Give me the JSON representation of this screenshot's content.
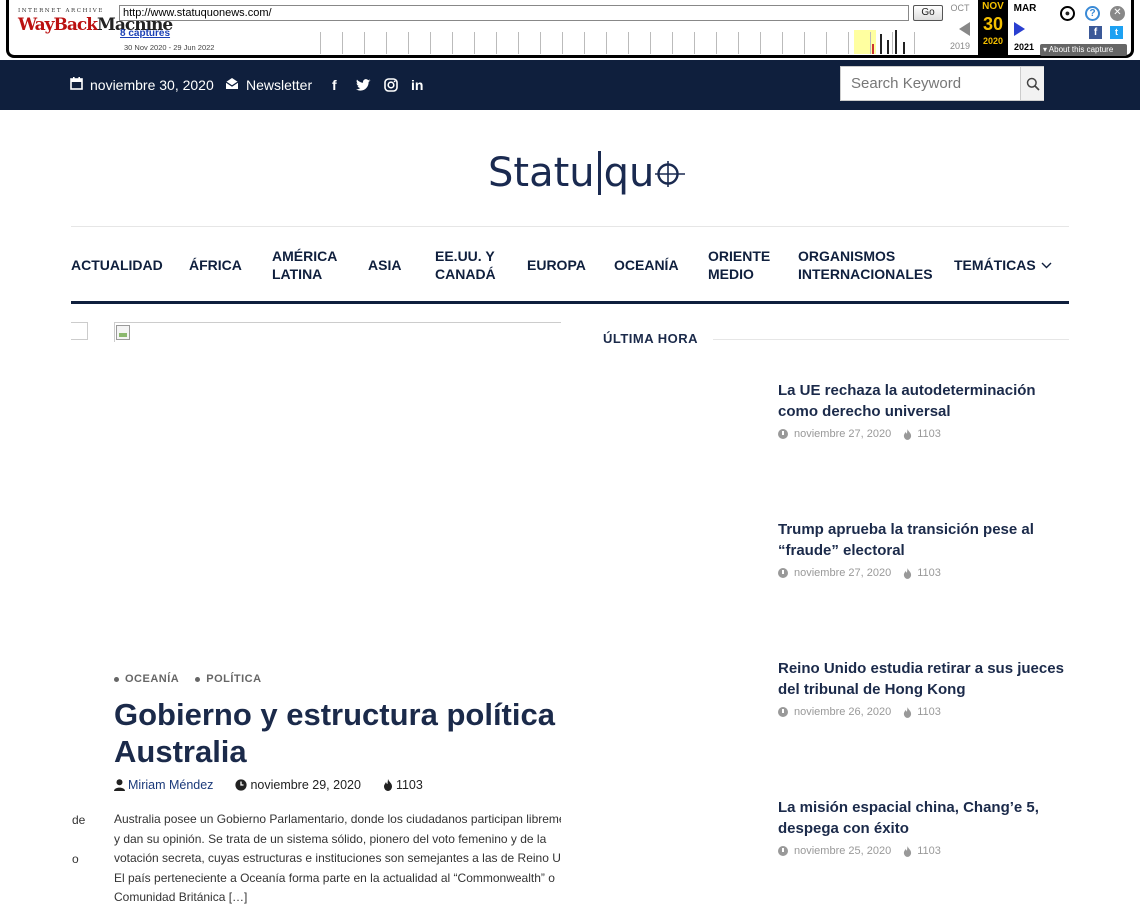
{
  "wayback": {
    "logo_top": "INTERNET ARCHIVE",
    "logo_main_red": "WayBack",
    "logo_main_dark": "Machine",
    "url": "http://www.statuquonews.com/",
    "go_label": "Go",
    "captures_link": "8 captures",
    "capture_range": "30 Nov 2020 - 29 Jun 2022",
    "prev_month": "OCT",
    "prev_year": "2019",
    "cur_month": "NOV",
    "cur_day": "30",
    "cur_year": "2020",
    "next_month": "MAR",
    "next_year": "2021",
    "about_label": "About this capture",
    "icons": [
      "user-icon",
      "help-icon",
      "close-icon",
      "facebook-icon",
      "twitter-icon"
    ]
  },
  "topbar": {
    "date": "noviembre 30, 2020",
    "newsletter": "Newsletter",
    "social": [
      "facebook-icon",
      "twitter-icon",
      "instagram-icon",
      "linkedin-icon"
    ],
    "search_placeholder": "Search Keyword",
    "bg_color": "#0f1f3d"
  },
  "logo": {
    "left": "Statu",
    "right": "qu"
  },
  "nav": [
    {
      "label": "ACTUALIDAD"
    },
    {
      "label": "ÁFRICA"
    },
    {
      "label": "AMÉRICA\nLATINA"
    },
    {
      "label": "ASIA"
    },
    {
      "label": "EE.UU. Y\nCANADÁ"
    },
    {
      "label": "EUROPA"
    },
    {
      "label": "OCEANÍA"
    },
    {
      "label": "ORIENTE\nMEDIO"
    },
    {
      "label": "ORGANISMOS\nINTERNACIONALES"
    },
    {
      "label": "TEMÁTICAS"
    }
  ],
  "article": {
    "categories": [
      "OCEANÍA",
      "POLÍTICA"
    ],
    "title_line1": "Gobierno y estructura política de",
    "title_line2": "Australia",
    "author": "Miriam Méndez",
    "date": "noviembre 29, 2020",
    "views": "1103",
    "body": [
      "Australia posee un Gobierno Parlamentario, donde los ciudadanos participan libremente",
      "y dan su opinión. Se trata de un sistema sólido, pionero del voto femenino y de la",
      "votación secreta, cuyas estructuras e instituciones son semejantes a las de Reino Unido.",
      "El país perteneciente a Oceanía forma parte en la actualidad al “Commonwealth” o",
      "Comunidad Británica […]"
    ],
    "left_fragments": [
      "de",
      "o"
    ]
  },
  "ultima_hora": {
    "heading": "ÚLTIMA HORA",
    "items": [
      {
        "title": "La UE rechaza la autodeterminación como derecho universal",
        "date": "noviembre 27, 2020",
        "views": "1103"
      },
      {
        "title": "Trump aprueba la transición pese al “fraude” electoral",
        "date": "noviembre 27, 2020",
        "views": "1103"
      },
      {
        "title": "Reino Unido estudia retirar a sus jueces del tribunal de Hong Kong",
        "date": "noviembre 26, 2020",
        "views": "1103"
      },
      {
        "title": "La misión espacial china, Chang’e 5, despega con éxito",
        "date": "noviembre 25, 2020",
        "views": "1103"
      }
    ]
  }
}
